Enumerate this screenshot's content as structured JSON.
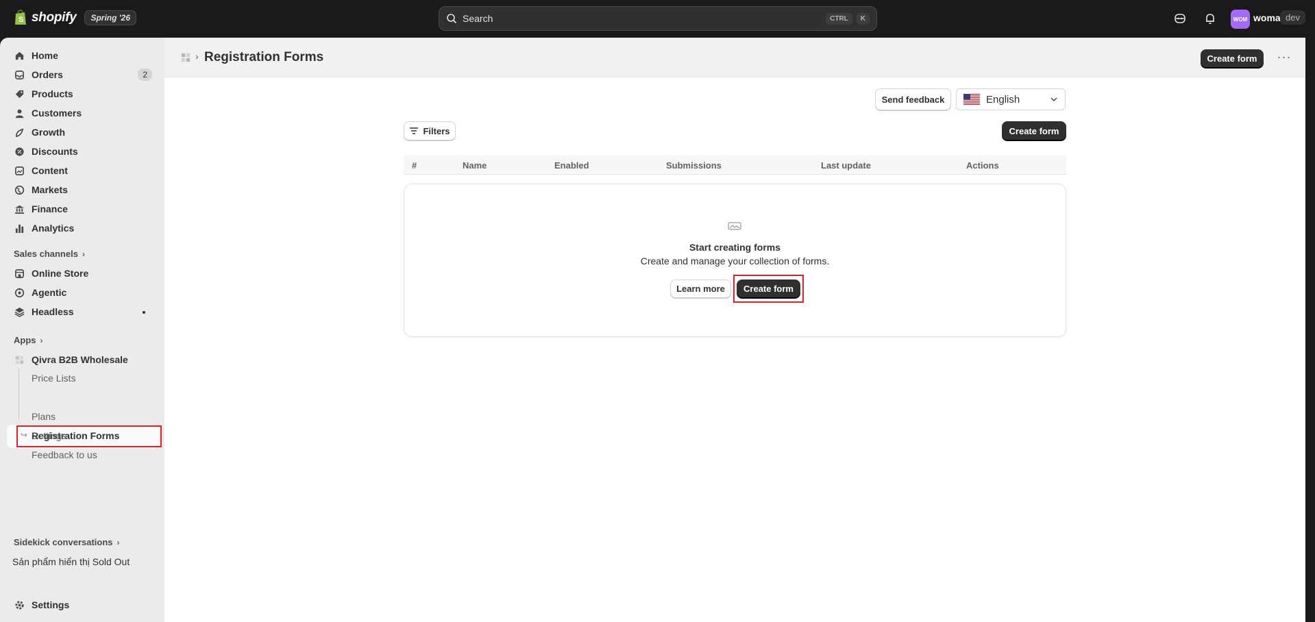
{
  "topbar": {
    "brand": "shopify",
    "edition": "Spring '26",
    "search_placeholder": "Search",
    "shortcut_ctrl": "CTRL",
    "shortcut_key": "K",
    "avatar_initials": "WOM",
    "store_name": "woma",
    "store_badge": "dev"
  },
  "sidebar": {
    "items": [
      {
        "label": "Home",
        "icon": "home-icon"
      },
      {
        "label": "Orders",
        "icon": "orders-icon",
        "badge": "2"
      },
      {
        "label": "Products",
        "icon": "tag-icon"
      },
      {
        "label": "Customers",
        "icon": "person-icon"
      },
      {
        "label": "Growth",
        "icon": "growth-icon"
      },
      {
        "label": "Discounts",
        "icon": "discount-icon"
      },
      {
        "label": "Content",
        "icon": "content-icon"
      },
      {
        "label": "Markets",
        "icon": "globe-icon"
      },
      {
        "label": "Finance",
        "icon": "bank-icon"
      },
      {
        "label": "Analytics",
        "icon": "bar-chart-icon"
      }
    ],
    "sales_channels_label": "Sales channels",
    "channels": [
      {
        "label": "Online Store",
        "icon": "store-icon"
      },
      {
        "label": "Agentic",
        "icon": "agentic-icon"
      },
      {
        "label": "Headless",
        "icon": "headless-icon"
      }
    ],
    "apps_label": "Apps",
    "app_name": "Qivra B2B Wholesale",
    "app_subitems": [
      "Price Lists",
      "Registration Forms",
      "Plans",
      "Settings",
      "Feedback to us"
    ],
    "sidekick_label": "Sidekick conversations",
    "sidekick_item": "Sản phẩm hiển thị Sold Out",
    "settings_label": "Settings"
  },
  "page": {
    "title": "Registration Forms",
    "header_create_label": "Create form",
    "send_feedback_label": "Send feedback",
    "language": "English",
    "filters_label": "Filters",
    "create_label": "Create form",
    "table_columns": [
      "#",
      "Name",
      "Enabled",
      "Submissions",
      "Last update",
      "Actions"
    ],
    "empty_title": "Start creating forms",
    "empty_desc": "Create and manage your collection of forms.",
    "learn_more_label": "Learn more",
    "empty_create_label": "Create form"
  },
  "colors": {
    "topbar_bg": "#1a1a1a",
    "sidebar_bg": "#ebebeb",
    "primary_button": "#303030",
    "highlight": "#e11d26",
    "avatar_bg": "#a46bf5"
  }
}
